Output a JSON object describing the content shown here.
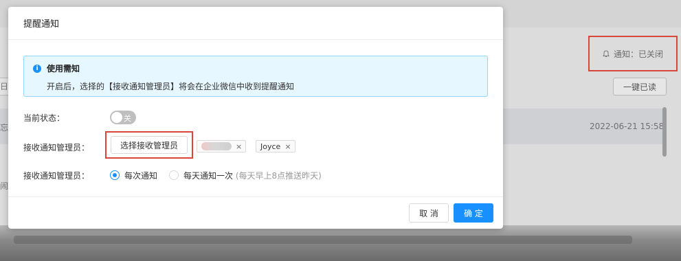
{
  "background": {
    "notice_text": "通知：已关闭",
    "read_all_label": "一键已读",
    "row_time": "2022-06-21 15:58",
    "left_frag_1": "日",
    "left_frag_2": "忘",
    "left_frag_3": "闹会"
  },
  "modal": {
    "title": "提醒通知",
    "alert": {
      "title": "使用需知",
      "text": "开启后，选择的【接收通知管理员】将会在企业微信中收到提醒通知"
    },
    "status": {
      "label": "当前状态：",
      "toggle_text": "关",
      "toggle_on": false
    },
    "admins": {
      "label": "接收通知管理员：",
      "select_button": "选择接收管理员",
      "tags": [
        {
          "name": ""
        },
        {
          "name": "Joyce"
        }
      ],
      "tag_close": "×"
    },
    "frequency": {
      "label": "接收通知管理员：",
      "options": [
        {
          "label": "每次通知",
          "checked": true
        },
        {
          "label": "每天通知一次",
          "hint": "(每天早上8点推送昨天)",
          "checked": false
        }
      ]
    },
    "footer": {
      "cancel": "取 消",
      "ok": "确 定"
    }
  },
  "colors": {
    "primary": "#1890ff",
    "highlight_border": "#d9443b",
    "alert_bg": "#e6f7ff"
  }
}
